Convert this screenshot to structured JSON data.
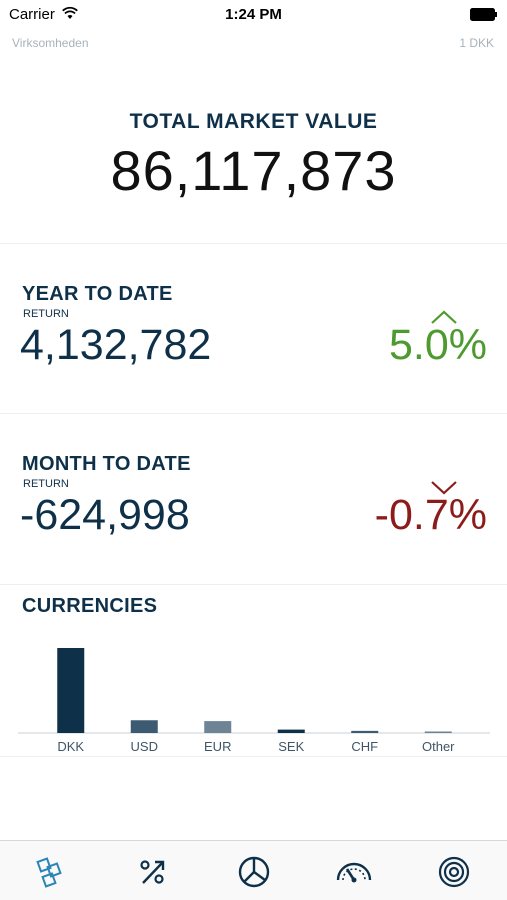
{
  "status_bar": {
    "carrier": "Carrier",
    "time": "1:24 PM"
  },
  "header": {
    "company": "Virksomheden",
    "unit": "1 DKK"
  },
  "total": {
    "label": "TOTAL MARKET VALUE",
    "value": "86,117,873"
  },
  "ytd": {
    "title": "YEAR TO DATE",
    "subtitle": "RETURN",
    "amount": "4,132,782",
    "percent": "5.0%",
    "direction": "up",
    "color": "#4d9a2e"
  },
  "mtd": {
    "title": "MONTH TO DATE",
    "subtitle": "RETURN",
    "amount": "-624,998",
    "percent": "-0.7%",
    "direction": "down",
    "color": "#8c1c1c"
  },
  "currencies": {
    "title": "CURRENCIES"
  },
  "chart_data": {
    "type": "bar",
    "categories": [
      "DKK",
      "USD",
      "EUR",
      "SEK",
      "CHF",
      "Other"
    ],
    "values": [
      100,
      15,
      14,
      4,
      2.5,
      1.5
    ],
    "colors": [
      "#0f3049",
      "#3d5a73",
      "#6e8394",
      "#0f3049",
      "#3d5a73",
      "#6e8394"
    ],
    "ylim": [
      0,
      100
    ],
    "grid": false,
    "legend": "none"
  },
  "tab_bar": {
    "tabs": [
      {
        "icon": "portfolio-icon",
        "active": true
      },
      {
        "icon": "return-icon",
        "active": false
      },
      {
        "icon": "pie-chart-icon",
        "active": false
      },
      {
        "icon": "gauge-icon",
        "active": false
      },
      {
        "icon": "target-icon",
        "active": false
      }
    ]
  }
}
